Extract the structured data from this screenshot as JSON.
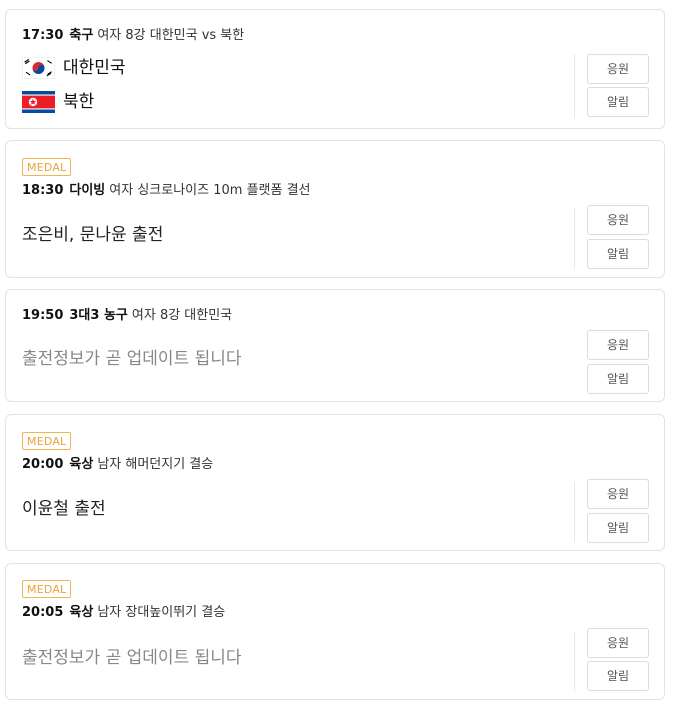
{
  "buttons": {
    "cheer": "응원",
    "alert": "알림"
  },
  "colors": {
    "medal_accent": "#e9a23b",
    "pending_text": "#888888",
    "card_border": "#e3e3e3"
  },
  "events": [
    {
      "time": "17:30",
      "sport": "축구",
      "desc": "여자 8강 대한민국 vs 북한",
      "teams": [
        {
          "name": "대한민국",
          "flag": "south-korea-flag-icon"
        },
        {
          "name": "북한",
          "flag": "north-korea-flag-icon"
        }
      ]
    },
    {
      "medal": "MEDAL",
      "time": "18:30",
      "sport": "다이빙",
      "desc": "여자 싱크로나이즈 10m 플랫폼 결선",
      "status": "조은비, 문나윤 출전"
    },
    {
      "time": "19:50",
      "sport": "3대3 농구",
      "desc": "여자 8강 대한민국",
      "status": "출전정보가 곧 업데이트 됩니다"
    },
    {
      "medal": "MEDAL",
      "time": "20:00",
      "sport": "육상",
      "desc": "남자 해머던지기 결승",
      "status": "이윤철 출전"
    },
    {
      "medal": "MEDAL",
      "time": "20:05",
      "sport": "육상",
      "desc": "남자 장대높이뛰기 결승",
      "status": "출전정보가 곧 업데이트 됩니다"
    }
  ]
}
